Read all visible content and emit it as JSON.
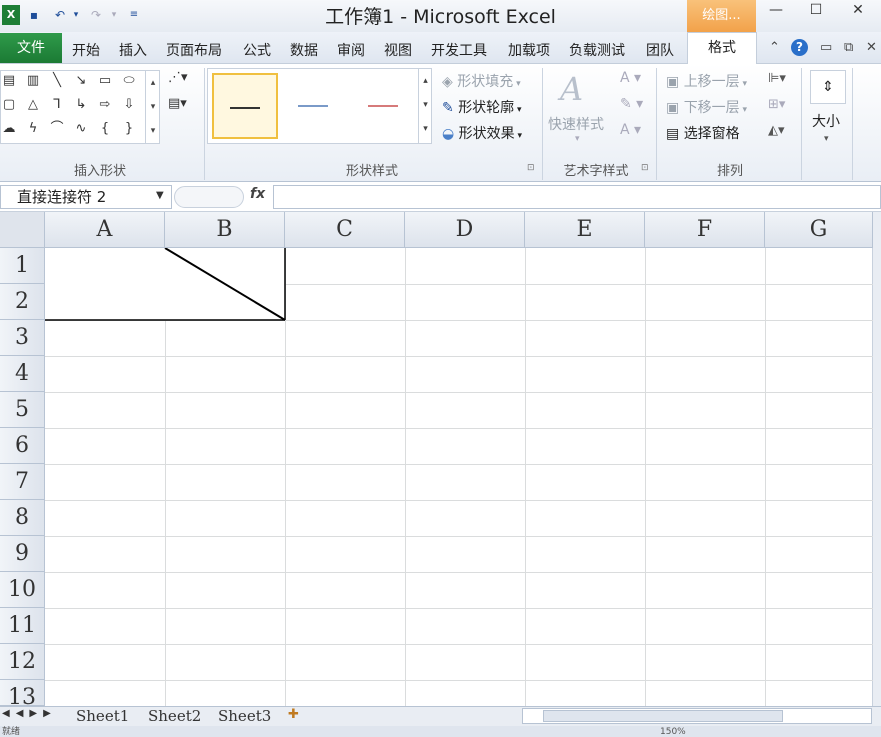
{
  "window": {
    "title": "工作簿1  -  Microsoft Excel",
    "context_tab": "绘图...",
    "min": "—",
    "max": "☐",
    "close": "✕"
  },
  "tabs": {
    "file": "文件",
    "items": [
      "开始",
      "插入",
      "页面布局",
      "公式",
      "数据",
      "审阅",
      "视图",
      "开发工具",
      "加载项",
      "负载测试",
      "团队"
    ],
    "format": "格式"
  },
  "ribbon": {
    "insert_shapes_label": "插入形状",
    "shape_styles_label": "形状样式",
    "wordart_label": "艺术字样式",
    "arrange_label": "排列",
    "shape_fill": "形状填充",
    "shape_outline": "形状轮廓",
    "shape_effects": "形状效果",
    "quick_styles": "快速样式",
    "bring_forward": "上移一层",
    "send_backward": "下移一层",
    "selection_pane": "选择窗格",
    "size": "大小"
  },
  "formula_bar": {
    "name_box": "直接连接符  2",
    "fx": "fx",
    "formula": ""
  },
  "grid": {
    "columns": [
      "A",
      "B",
      "C",
      "D",
      "E",
      "F",
      "G"
    ],
    "rows": [
      "1",
      "2",
      "3",
      "4",
      "5",
      "6",
      "7",
      "8",
      "9",
      "10",
      "11",
      "12",
      "13"
    ]
  },
  "sheets": [
    "Sheet1",
    "Sheet2",
    "Sheet3"
  ],
  "status": {
    "ready": "就绪",
    "zoom": "150%"
  },
  "colors": {
    "file_tab": "#1e7e36",
    "context_tab": "#f2a24a",
    "grid_line": "#dadcdd",
    "header_bg": "#dde3ec"
  }
}
